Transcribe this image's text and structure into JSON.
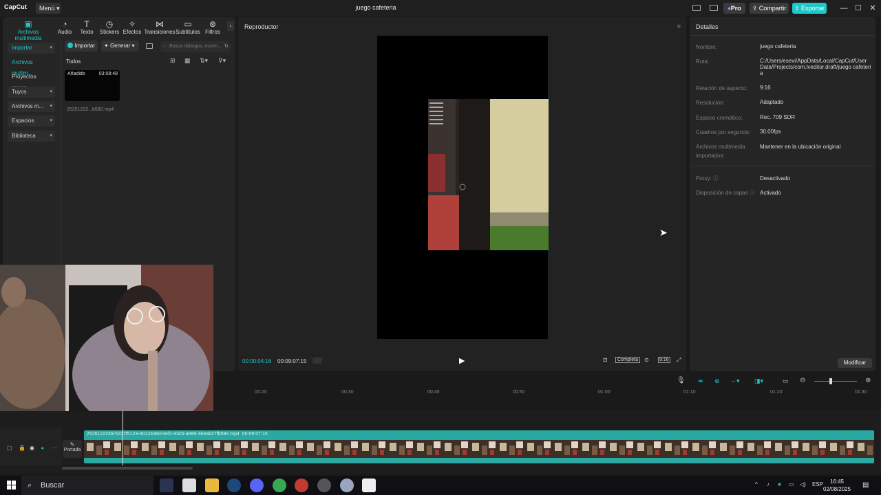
{
  "window": {
    "logo": "CapCut",
    "menu_label": "Menú",
    "title": "juego cafeteria",
    "pro_label": "Pro",
    "share_label": "Compartir",
    "export_label": "Exportar"
  },
  "toolbar": {
    "tabs": [
      {
        "label": "Archivos multimedia",
        "icon": "media-icon"
      },
      {
        "label": "Audio",
        "icon": "audio-icon"
      },
      {
        "label": "Texto",
        "icon": "text-icon"
      },
      {
        "label": "Stickers",
        "icon": "sticker-icon"
      },
      {
        "label": "Efectos",
        "icon": "effects-icon"
      },
      {
        "label": "Transiciones",
        "icon": "transitions-icon"
      },
      {
        "label": "Subtítulos",
        "icon": "subtitles-icon"
      },
      {
        "label": "Filtros",
        "icon": "filters-icon"
      }
    ]
  },
  "sidebar": {
    "items": [
      {
        "label": "Importar"
      },
      {
        "label": "Archivos multim..."
      },
      {
        "label": "Proyectos secun..."
      },
      {
        "label": "Tuyos"
      },
      {
        "label": "Archivos m..."
      },
      {
        "label": "Espacios"
      },
      {
        "label": "Biblioteca"
      }
    ]
  },
  "media": {
    "import_label": "Importar",
    "generate_label": "Generar",
    "search_placeholder": "Busca diálogos, escen...",
    "filter_all": "Todos",
    "clip_badge": "Añadido",
    "clip_duration": "03:08:48",
    "clip_name": "25251222...b590.mp4"
  },
  "player": {
    "title": "Reproductor",
    "current_time": "00:00:04:16",
    "total_time": "00:09:07:15",
    "full_label": "Completa",
    "ratio_label": "9:16"
  },
  "details": {
    "title": "Detalles",
    "rows": [
      {
        "key": "Nombre:",
        "value": "juego cafeteria"
      },
      {
        "key": "Ruta:",
        "value": "C:/Users/esevi/AppData/Local/CapCut/User Data/Projects/com.lveditor.draft/juego cafeteria"
      },
      {
        "key": "Relación de aspecto:",
        "value": "9:16"
      },
      {
        "key": "Resolución:",
        "value": "Adaptado"
      },
      {
        "key": "Espacio cromático:",
        "value": "Rec. 709 SDR"
      },
      {
        "key": "Cuadros por segundo:",
        "value": "30.00fps"
      },
      {
        "key": "Archivos multimedia importados:",
        "value": "Mantener en la ubicación original"
      },
      {
        "key": "Proxy:",
        "value": "Desactivado"
      },
      {
        "key": "Disposición de capas",
        "value": "Activado"
      }
    ],
    "modify_label": "Modificar"
  },
  "timeline": {
    "ruler": [
      "00:20",
      "00:30",
      "00:40",
      "00:50",
      "01:00",
      "01:10",
      "01:20",
      "01:30"
    ],
    "clip_label": "2526122249-5227f5123-eb1243ed-0ef2-43cb-a689-3beab47fb590.mp4",
    "clip_duration": "00:09:07:15",
    "cover_label": "Portada"
  },
  "taskbar": {
    "search_label": "Buscar",
    "language": "ESP",
    "time": "16:45",
    "date": "02/08/2025"
  }
}
